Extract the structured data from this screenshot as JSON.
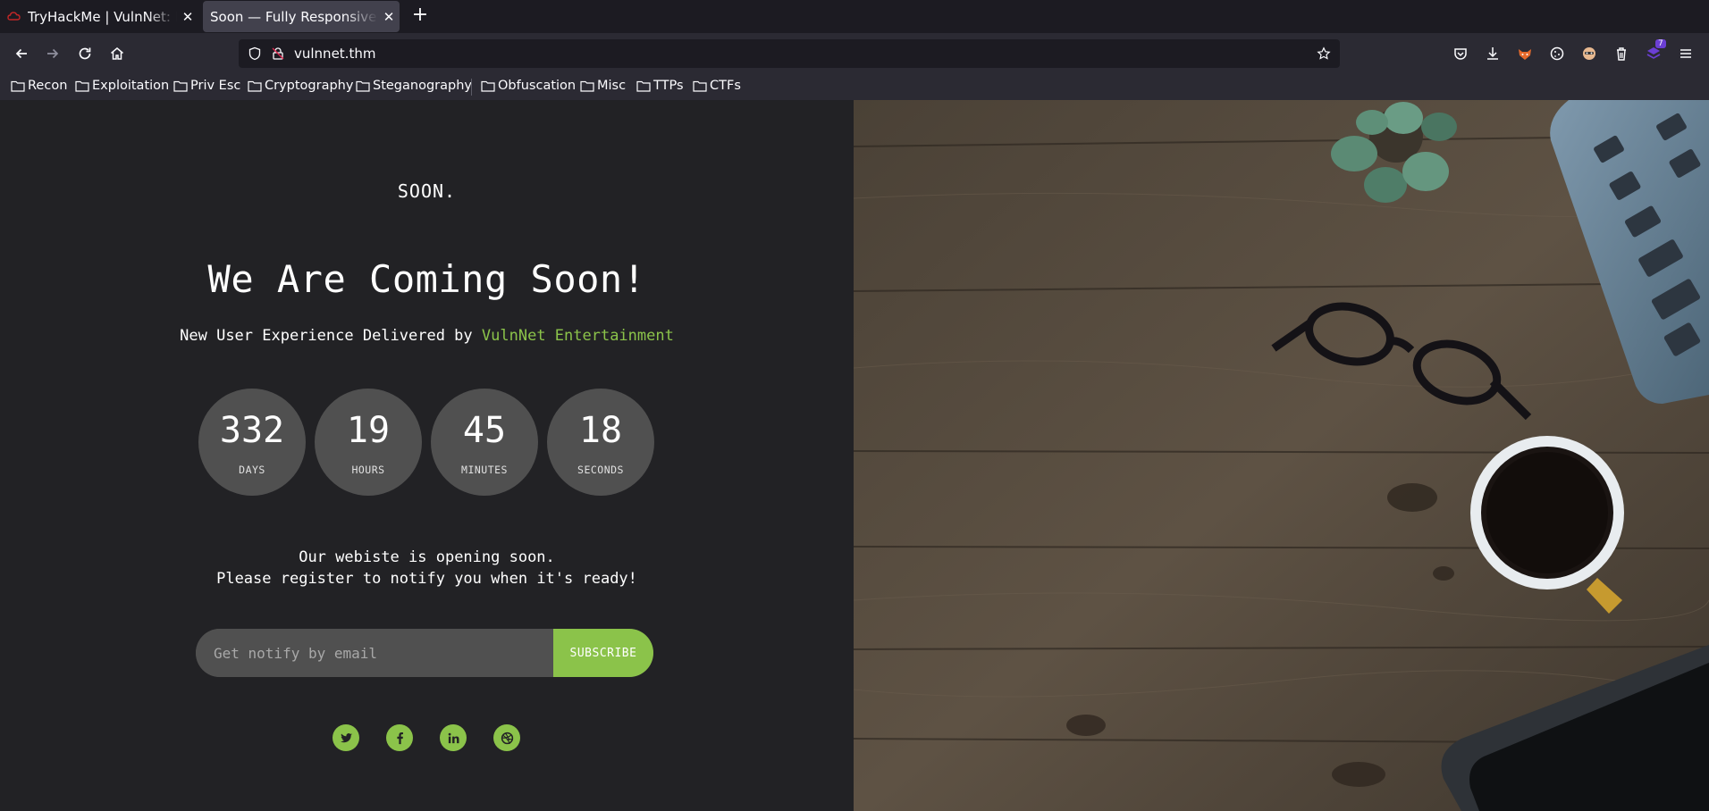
{
  "browser": {
    "tabs": [
      {
        "title": "TryHackMe | VulnNet: Enc",
        "active": false
      },
      {
        "title": "Soon — Fully Responsive Sof",
        "active": true
      }
    ],
    "url": "vulnnet.thm",
    "extension_badge": "7",
    "bookmarks": [
      "Recon",
      "Exploitation",
      "Priv Esc",
      "Cryptography",
      "Steganography",
      "Obfuscation",
      "Misc",
      "TTPs",
      "CTFs"
    ]
  },
  "page": {
    "logo": "SOON.",
    "headline": "We Are Coming Soon!",
    "tagline_prefix": "New User Experience Delivered by ",
    "tagline_brand": "VulnNet Entertainment",
    "countdown": [
      {
        "value": "332",
        "unit": "DAYS"
      },
      {
        "value": "19",
        "unit": "HOURS"
      },
      {
        "value": "45",
        "unit": "MINUTES"
      },
      {
        "value": "18",
        "unit": "SECONDS"
      }
    ],
    "message_line1": "Our webiste is opening soon.",
    "message_line2": "Please register to notify you when it's ready!",
    "email_placeholder": "Get notify by email",
    "subscribe_label": "SUBSCRIBE",
    "social": [
      "twitter-icon",
      "facebook-icon",
      "linkedin-icon",
      "dribbble-icon"
    ]
  },
  "colors": {
    "accent": "#8bc34a",
    "page_bg": "#222225",
    "circle_bg": "#505050",
    "chrome_bg": "#2b2a33"
  }
}
